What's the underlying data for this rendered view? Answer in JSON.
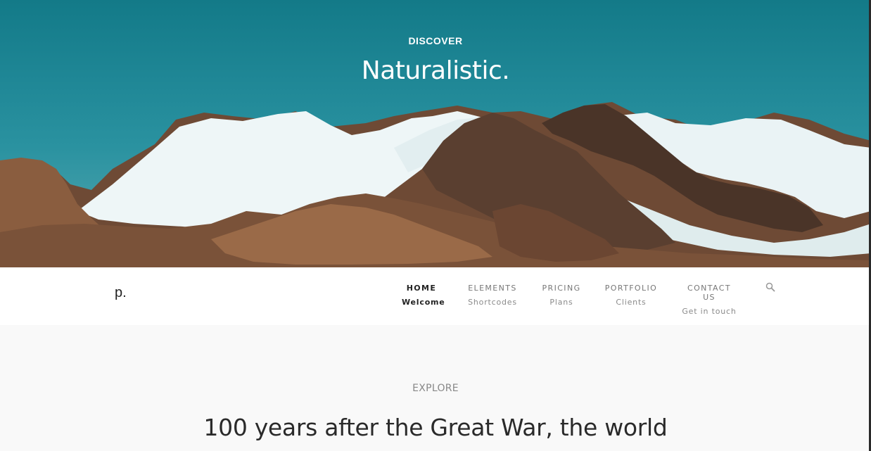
{
  "hero": {
    "kicker": "DISCOVER",
    "title": "Naturalistic."
  },
  "header": {
    "logo": "p.",
    "nav": [
      {
        "label": "HOME",
        "sub": "Welcome",
        "active": true
      },
      {
        "label": "ELEMENTS",
        "sub": "Shortcodes",
        "active": false
      },
      {
        "label": "PRICING",
        "sub": "Plans",
        "active": false
      },
      {
        "label": "PORTFOLIO",
        "sub": "Clients",
        "active": false
      },
      {
        "label": "CONTACT US",
        "sub": "Get in touch",
        "active": false
      }
    ],
    "search_icon": "search-icon"
  },
  "section": {
    "eyebrow": "EXPLORE",
    "headline": "100 years after the Great War, the world"
  },
  "colors": {
    "sky": "#1f8796",
    "nav_bg": "#ffffff",
    "page_bg": "#f9f9f9",
    "text_dark": "#222222"
  }
}
